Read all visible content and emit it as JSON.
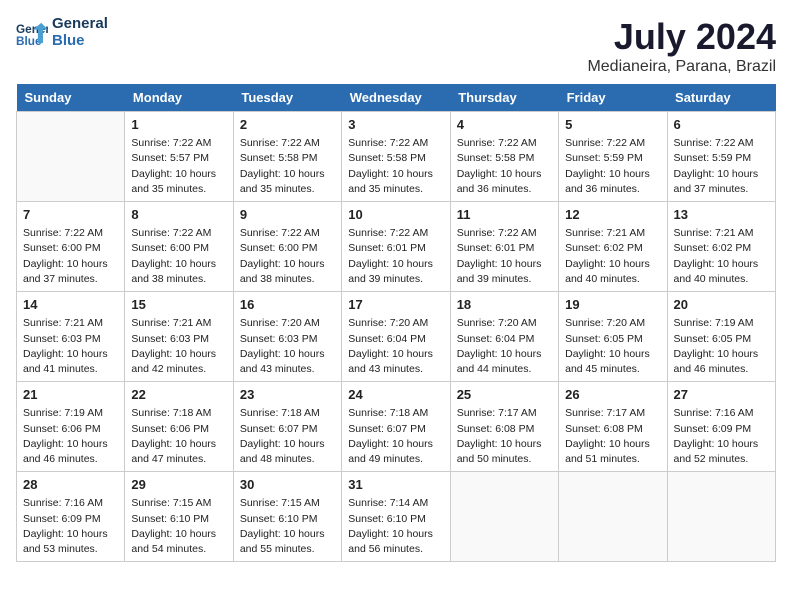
{
  "logo": {
    "line1": "General",
    "line2": "Blue"
  },
  "title": "July 2024",
  "location": "Medianeira, Parana, Brazil",
  "weekdays": [
    "Sunday",
    "Monday",
    "Tuesday",
    "Wednesday",
    "Thursday",
    "Friday",
    "Saturday"
  ],
  "weeks": [
    [
      {
        "day": "",
        "info": ""
      },
      {
        "day": "1",
        "info": "Sunrise: 7:22 AM\nSunset: 5:57 PM\nDaylight: 10 hours\nand 35 minutes."
      },
      {
        "day": "2",
        "info": "Sunrise: 7:22 AM\nSunset: 5:58 PM\nDaylight: 10 hours\nand 35 minutes."
      },
      {
        "day": "3",
        "info": "Sunrise: 7:22 AM\nSunset: 5:58 PM\nDaylight: 10 hours\nand 35 minutes."
      },
      {
        "day": "4",
        "info": "Sunrise: 7:22 AM\nSunset: 5:58 PM\nDaylight: 10 hours\nand 36 minutes."
      },
      {
        "day": "5",
        "info": "Sunrise: 7:22 AM\nSunset: 5:59 PM\nDaylight: 10 hours\nand 36 minutes."
      },
      {
        "day": "6",
        "info": "Sunrise: 7:22 AM\nSunset: 5:59 PM\nDaylight: 10 hours\nand 37 minutes."
      }
    ],
    [
      {
        "day": "7",
        "info": "Sunrise: 7:22 AM\nSunset: 6:00 PM\nDaylight: 10 hours\nand 37 minutes."
      },
      {
        "day": "8",
        "info": "Sunrise: 7:22 AM\nSunset: 6:00 PM\nDaylight: 10 hours\nand 38 minutes."
      },
      {
        "day": "9",
        "info": "Sunrise: 7:22 AM\nSunset: 6:00 PM\nDaylight: 10 hours\nand 38 minutes."
      },
      {
        "day": "10",
        "info": "Sunrise: 7:22 AM\nSunset: 6:01 PM\nDaylight: 10 hours\nand 39 minutes."
      },
      {
        "day": "11",
        "info": "Sunrise: 7:22 AM\nSunset: 6:01 PM\nDaylight: 10 hours\nand 39 minutes."
      },
      {
        "day": "12",
        "info": "Sunrise: 7:21 AM\nSunset: 6:02 PM\nDaylight: 10 hours\nand 40 minutes."
      },
      {
        "day": "13",
        "info": "Sunrise: 7:21 AM\nSunset: 6:02 PM\nDaylight: 10 hours\nand 40 minutes."
      }
    ],
    [
      {
        "day": "14",
        "info": "Sunrise: 7:21 AM\nSunset: 6:03 PM\nDaylight: 10 hours\nand 41 minutes."
      },
      {
        "day": "15",
        "info": "Sunrise: 7:21 AM\nSunset: 6:03 PM\nDaylight: 10 hours\nand 42 minutes."
      },
      {
        "day": "16",
        "info": "Sunrise: 7:20 AM\nSunset: 6:03 PM\nDaylight: 10 hours\nand 43 minutes."
      },
      {
        "day": "17",
        "info": "Sunrise: 7:20 AM\nSunset: 6:04 PM\nDaylight: 10 hours\nand 43 minutes."
      },
      {
        "day": "18",
        "info": "Sunrise: 7:20 AM\nSunset: 6:04 PM\nDaylight: 10 hours\nand 44 minutes."
      },
      {
        "day": "19",
        "info": "Sunrise: 7:20 AM\nSunset: 6:05 PM\nDaylight: 10 hours\nand 45 minutes."
      },
      {
        "day": "20",
        "info": "Sunrise: 7:19 AM\nSunset: 6:05 PM\nDaylight: 10 hours\nand 46 minutes."
      }
    ],
    [
      {
        "day": "21",
        "info": "Sunrise: 7:19 AM\nSunset: 6:06 PM\nDaylight: 10 hours\nand 46 minutes."
      },
      {
        "day": "22",
        "info": "Sunrise: 7:18 AM\nSunset: 6:06 PM\nDaylight: 10 hours\nand 47 minutes."
      },
      {
        "day": "23",
        "info": "Sunrise: 7:18 AM\nSunset: 6:07 PM\nDaylight: 10 hours\nand 48 minutes."
      },
      {
        "day": "24",
        "info": "Sunrise: 7:18 AM\nSunset: 6:07 PM\nDaylight: 10 hours\nand 49 minutes."
      },
      {
        "day": "25",
        "info": "Sunrise: 7:17 AM\nSunset: 6:08 PM\nDaylight: 10 hours\nand 50 minutes."
      },
      {
        "day": "26",
        "info": "Sunrise: 7:17 AM\nSunset: 6:08 PM\nDaylight: 10 hours\nand 51 minutes."
      },
      {
        "day": "27",
        "info": "Sunrise: 7:16 AM\nSunset: 6:09 PM\nDaylight: 10 hours\nand 52 minutes."
      }
    ],
    [
      {
        "day": "28",
        "info": "Sunrise: 7:16 AM\nSunset: 6:09 PM\nDaylight: 10 hours\nand 53 minutes."
      },
      {
        "day": "29",
        "info": "Sunrise: 7:15 AM\nSunset: 6:10 PM\nDaylight: 10 hours\nand 54 minutes."
      },
      {
        "day": "30",
        "info": "Sunrise: 7:15 AM\nSunset: 6:10 PM\nDaylight: 10 hours\nand 55 minutes."
      },
      {
        "day": "31",
        "info": "Sunrise: 7:14 AM\nSunset: 6:10 PM\nDaylight: 10 hours\nand 56 minutes."
      },
      {
        "day": "",
        "info": ""
      },
      {
        "day": "",
        "info": ""
      },
      {
        "day": "",
        "info": ""
      }
    ]
  ]
}
